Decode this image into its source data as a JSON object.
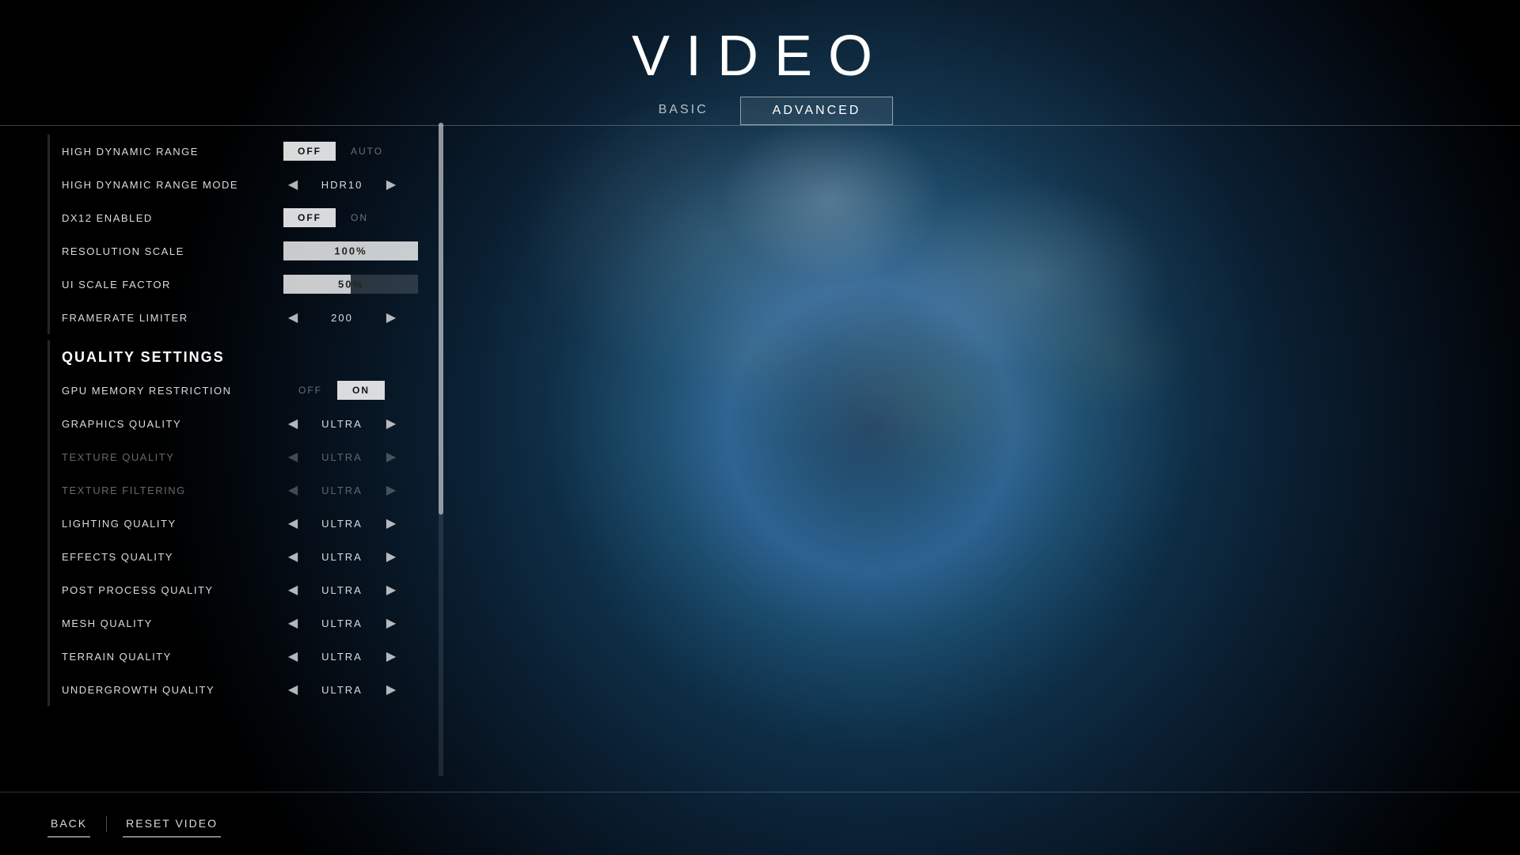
{
  "page": {
    "title": "VIDEO",
    "background_description": "Earth globe background"
  },
  "tabs": {
    "items": [
      {
        "id": "basic",
        "label": "BASIC",
        "active": false
      },
      {
        "id": "advanced",
        "label": "ADVANCED",
        "active": true
      }
    ]
  },
  "settings": {
    "sections": [
      {
        "type": "rows",
        "rows": [
          {
            "id": "high_dynamic_range",
            "label": "HIGH DYNAMIC RANGE",
            "control": "toggle",
            "left_value": "OFF",
            "right_value": "AUTO",
            "active": "left"
          },
          {
            "id": "high_dynamic_range_mode",
            "label": "HIGH DYNAMIC RANGE MODE",
            "control": "arrow",
            "value": "HDR10"
          },
          {
            "id": "dx12_enabled",
            "label": "DX12 ENABLED",
            "control": "toggle",
            "left_value": "OFF",
            "right_value": "ON",
            "active": "left"
          },
          {
            "id": "resolution_scale",
            "label": "RESOLUTION SCALE",
            "control": "slider",
            "value": "100%",
            "fill_percent": 100
          },
          {
            "id": "ui_scale_factor",
            "label": "UI SCALE FACTOR",
            "control": "slider",
            "value": "50%",
            "fill_percent": 50
          },
          {
            "id": "framerate_limiter",
            "label": "FRAMERATE LIMITER",
            "control": "arrow",
            "value": "200"
          }
        ]
      },
      {
        "type": "header",
        "label": "QUALITY SETTINGS"
      },
      {
        "type": "rows",
        "rows": [
          {
            "id": "gpu_memory_restriction",
            "label": "GPU MEMORY RESTRICTION",
            "control": "toggle",
            "left_value": "OFF",
            "right_value": "ON",
            "active": "right"
          },
          {
            "id": "graphics_quality",
            "label": "GRAPHICS QUALITY",
            "control": "arrow",
            "value": "ULTRA",
            "dimmed": false
          },
          {
            "id": "texture_quality",
            "label": "TEXTURE QUALITY",
            "control": "arrow",
            "value": "ULTRA",
            "dimmed": true
          },
          {
            "id": "texture_filtering",
            "label": "TEXTURE FILTERING",
            "control": "arrow",
            "value": "ULTRA",
            "dimmed": true
          },
          {
            "id": "lighting_quality",
            "label": "LIGHTING QUALITY",
            "control": "arrow",
            "value": "ULTRA",
            "dimmed": false
          },
          {
            "id": "effects_quality",
            "label": "EFFECTS QUALITY",
            "control": "arrow",
            "value": "ULTRA",
            "dimmed": false
          },
          {
            "id": "post_process_quality",
            "label": "POST PROCESS QUALITY",
            "control": "arrow",
            "value": "ULTRA",
            "dimmed": false
          },
          {
            "id": "mesh_quality",
            "label": "MESH QUALITY",
            "control": "arrow",
            "value": "ULTRA",
            "dimmed": false
          },
          {
            "id": "terrain_quality",
            "label": "TERRAIN QUALITY",
            "control": "arrow",
            "value": "ULTRA",
            "dimmed": false
          },
          {
            "id": "undergrowth_quality",
            "label": "UNDERGROWTH QUALITY",
            "control": "arrow",
            "value": "ULTRA",
            "dimmed": false
          }
        ]
      }
    ]
  },
  "bottom_bar": {
    "back_label": "BACK",
    "reset_label": "RESET VIDEO"
  }
}
